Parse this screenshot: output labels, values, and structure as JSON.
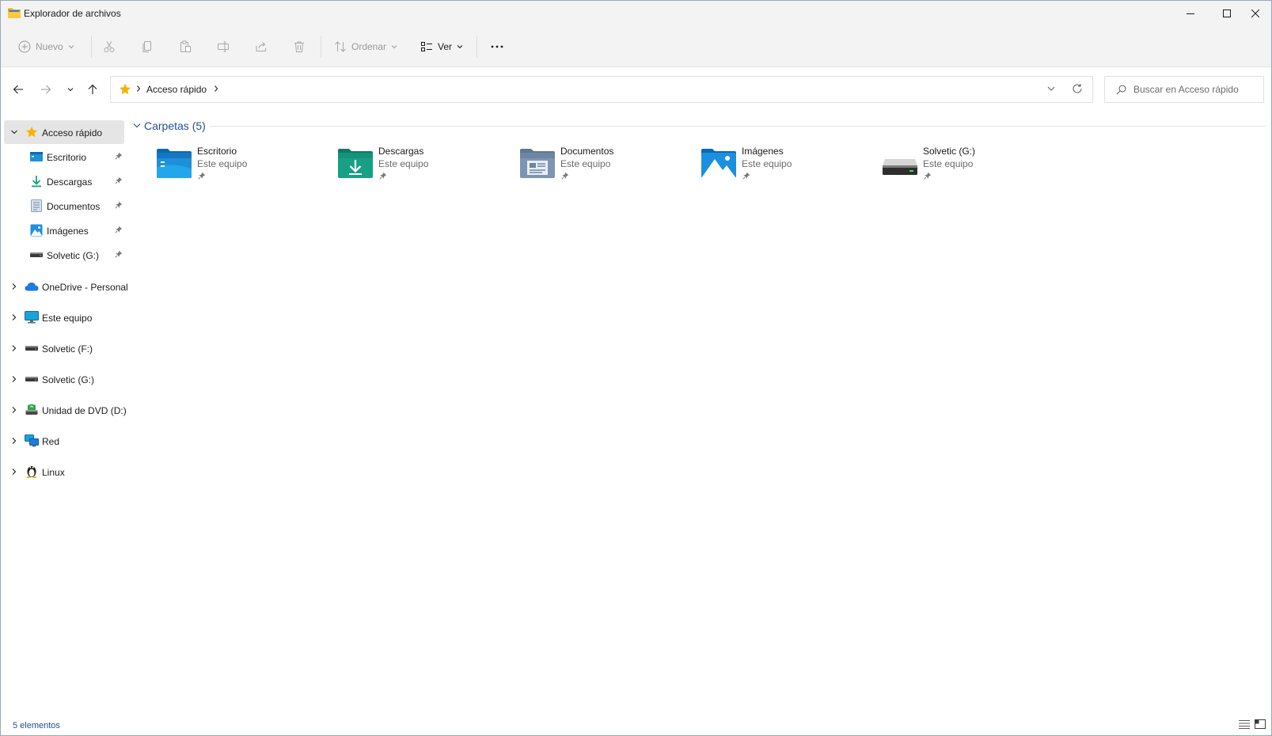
{
  "window": {
    "title": "Explorador de archivos"
  },
  "toolbar": {
    "new_label": "Nuevo",
    "sort_label": "Ordenar",
    "view_label": "Ver",
    "icons": [
      "plus-circle-icon",
      "cut-icon",
      "copy-icon",
      "paste-icon",
      "rename-icon",
      "share-icon",
      "delete-icon",
      "sort-icon",
      "view-icon",
      "more-icon"
    ]
  },
  "address": {
    "location": "Acceso rápido",
    "search_placeholder": "Buscar en Acceso rápido"
  },
  "sidebar": {
    "quick_access": {
      "label": "Acceso rápido",
      "expanded": true,
      "items": [
        {
          "label": "Escritorio",
          "icon": "desktop-folder-icon",
          "pinned": true
        },
        {
          "label": "Descargas",
          "icon": "download-icon",
          "pinned": true
        },
        {
          "label": "Documentos",
          "icon": "documents-icon",
          "pinned": true
        },
        {
          "label": "Imágenes",
          "icon": "pictures-icon",
          "pinned": true
        },
        {
          "label": "Solvetic (G:)",
          "icon": "drive-icon",
          "pinned": true
        }
      ]
    },
    "roots": [
      {
        "label": "OneDrive - Personal",
        "icon": "onedrive-cloud-icon"
      },
      {
        "label": "Este equipo",
        "icon": "computer-icon"
      },
      {
        "label": "Solvetic (F:)",
        "icon": "drive-icon"
      },
      {
        "label": "Solvetic (G:)",
        "icon": "drive-icon"
      },
      {
        "label": "Unidad de DVD (D:)",
        "icon": "dvd-drive-icon"
      },
      {
        "label": "Red",
        "icon": "network-icon"
      },
      {
        "label": "Linux",
        "icon": "linux-penguin-icon"
      }
    ]
  },
  "main": {
    "group_title": "Carpetas (5)",
    "folders": [
      {
        "name": "Escritorio",
        "location": "Este equipo",
        "icon": "desktop-folder-icon"
      },
      {
        "name": "Descargas",
        "location": "Este equipo",
        "icon": "downloads-folder-icon"
      },
      {
        "name": "Documentos",
        "location": "Este equipo",
        "icon": "documents-folder-icon"
      },
      {
        "name": "Imágenes",
        "location": "Este equipo",
        "icon": "pictures-folder-icon"
      },
      {
        "name": "Solvetic (G:)",
        "location": "Este equipo",
        "icon": "drive-icon"
      }
    ]
  },
  "status": {
    "item_count": "5 elementos"
  },
  "colors": {
    "accent": "#1f4e9c",
    "chrome": "#f3f3f3",
    "selection": "#e5e5e5",
    "star": "#f4b400"
  }
}
